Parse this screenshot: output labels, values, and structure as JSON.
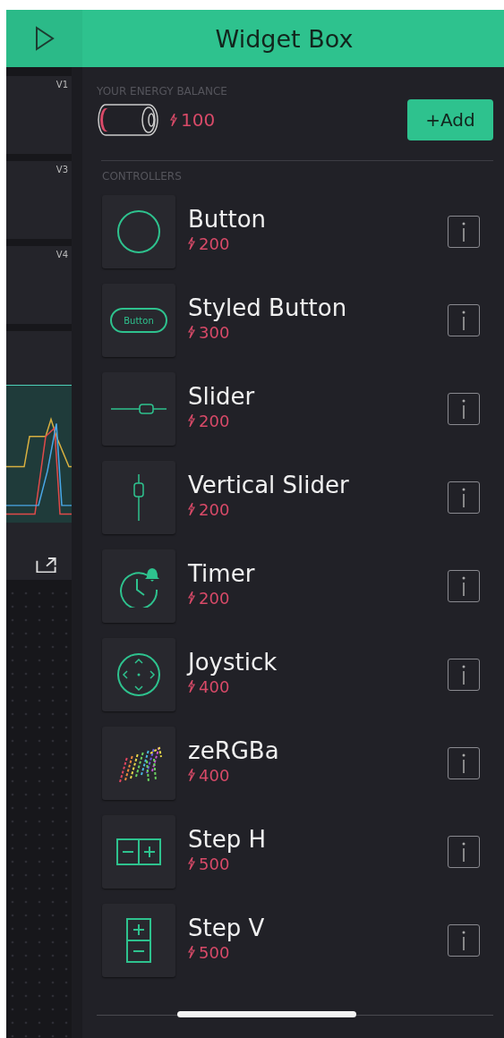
{
  "header": {
    "title": "Widget Box"
  },
  "dashboard": {
    "tiles": [
      {
        "label": "V1"
      },
      {
        "label": "V3"
      },
      {
        "label": "V4"
      }
    ]
  },
  "energy": {
    "label": "YOUR ENERGY BALANCE",
    "amount": "100",
    "add_button": "+Add"
  },
  "section_label": "CONTROLLERS",
  "widgets": [
    {
      "kind": "button",
      "name": "Button",
      "cost": "200"
    },
    {
      "kind": "styled-button",
      "name": "Styled Button",
      "cost": "300",
      "preview_text": "Button"
    },
    {
      "kind": "slider",
      "name": "Slider",
      "cost": "200"
    },
    {
      "kind": "vertical-slider",
      "name": "Vertical Slider",
      "cost": "200"
    },
    {
      "kind": "timer",
      "name": "Timer",
      "cost": "200"
    },
    {
      "kind": "joystick",
      "name": "Joystick",
      "cost": "400"
    },
    {
      "kind": "zergba",
      "name": "zeRGBa",
      "cost": "400"
    },
    {
      "kind": "step-h",
      "name": "Step H",
      "cost": "500"
    },
    {
      "kind": "step-v",
      "name": "Step V",
      "cost": "500"
    }
  ]
}
